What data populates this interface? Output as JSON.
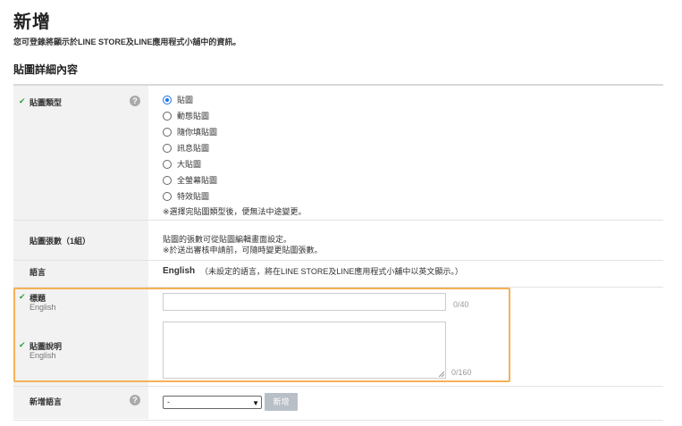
{
  "header": {
    "title": "新增",
    "description": "您可登錄將顯示於LINE STORE及LINE應用程式小舖中的資訊。"
  },
  "section": {
    "title": "貼圖詳細內容"
  },
  "form": {
    "sticker_type": {
      "label": "貼圖類型",
      "help": "?",
      "options": [
        "貼圖",
        "動態貼圖",
        "隨你填貼圖",
        "訊息貼圖",
        "大貼圖",
        "全螢幕貼圖",
        "特效貼圖"
      ],
      "selected": "貼圖",
      "note": "※選擇完貼圖類型後，便無法中途變更。"
    },
    "count": {
      "label": "貼圖張數（1組）",
      "line1": "貼圖的張數可從貼圖編輯畫面設定。",
      "line2": "※於送出審核申請前，可隨時變更貼圖張數。"
    },
    "language": {
      "label": "語言",
      "value": "English",
      "note": "（未設定的語言，將在LINE STORE及LINE應用程式小舖中以英文顯示。）"
    },
    "title_field": {
      "label": "標題",
      "sublabel": "English",
      "value": "",
      "counter": "0/40"
    },
    "description_field": {
      "label": "貼圖說明",
      "sublabel": "English",
      "value": "",
      "counter": "0/160"
    },
    "add_language": {
      "label": "新增語言",
      "help": "?",
      "selected": "-",
      "button": "新增"
    },
    "check_mark": "✔"
  },
  "colors": {
    "highlight": "#f4b256",
    "check": "#35a24a",
    "radio_selected": "#1a73e8"
  }
}
